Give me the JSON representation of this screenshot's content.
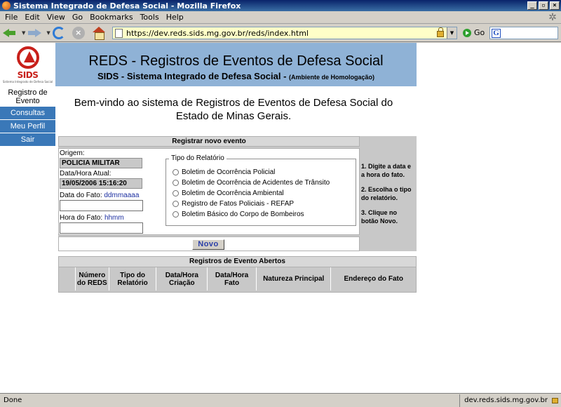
{
  "window": {
    "title": "Sistema Integrado de Defesa Social - Mozilla Firefox",
    "controls": {
      "minimize": "_",
      "maximize": "▫",
      "close": "×"
    }
  },
  "menu": [
    {
      "label": "File"
    },
    {
      "label": "Edit"
    },
    {
      "label": "View"
    },
    {
      "label": "Go"
    },
    {
      "label": "Bookmarks"
    },
    {
      "label": "Tools"
    },
    {
      "label": "Help"
    }
  ],
  "nav": {
    "url": "https://dev.reds.sids.mg.gov.br/reds/index.html",
    "go_label": "Go",
    "search_icon": "G"
  },
  "logo": {
    "text": "SIDS",
    "sub": "Sistema Integrado de Defesa Social"
  },
  "header": {
    "title": "REDS - Registros de Eventos de Defesa Social",
    "subtitle": "SIDS - Sistema Integrado de Defesa Social -",
    "env": "(Ambiente de Homologação)"
  },
  "sidebar": {
    "current": "Registro de Evento",
    "items": [
      {
        "label": "Consultas"
      },
      {
        "label": "Meu Perfil"
      },
      {
        "label": "Sair"
      }
    ]
  },
  "welcome": "Bem-vindo ao sistema de Registros de Eventos de Defesa Social do Estado de Minas Gerais.",
  "register": {
    "header": "Registrar novo evento",
    "origem_label": "Origem:",
    "origem_value": "POLICIA MILITAR",
    "datahora_label": "Data/Hora Atual:",
    "datahora_value": "19/05/2006 15:16:20",
    "data_fato_label": "Data do Fato:",
    "data_fato_hint": "ddmmaaaa",
    "data_fato_value": "",
    "hora_fato_label": "Hora do Fato:",
    "hora_fato_hint": "hhmm",
    "hora_fato_value": "",
    "tipo_legend": "Tipo do Relatório",
    "tipos": [
      {
        "label": "Boletim de Ocorrência Policial"
      },
      {
        "label": "Boletim de Ocorrência de Acidentes de Trânsito"
      },
      {
        "label": "Boletim de Ocorrência Ambiental"
      },
      {
        "label": "Registro de Fatos Policiais - REFAP"
      },
      {
        "label": "Boletim Básico do Corpo de Bombeiros"
      }
    ],
    "novo_label": "Novo"
  },
  "help": {
    "steps": [
      "1. Digite a data e a hora do fato.",
      "2. Escolha o tipo do relatório.",
      "3. Clique no botão Novo."
    ]
  },
  "open_events": {
    "header": "Registros de Evento Abertos",
    "columns": [
      "Número do REDS",
      "Tipo do Relatório",
      "Data/Hora Criação",
      "Data/Hora Fato",
      "Natureza Principal",
      "Endereço do Fato"
    ]
  },
  "status": {
    "left": "Done",
    "right": "dev.reds.sids.mg.gov.br"
  },
  "colors": {
    "header_band": "#8fb2d6",
    "sidebar_item": "#3a78b8",
    "panel_gray": "#c8c8c8",
    "logo_red": "#c8201a",
    "novo_text": "#2b3fa8"
  }
}
